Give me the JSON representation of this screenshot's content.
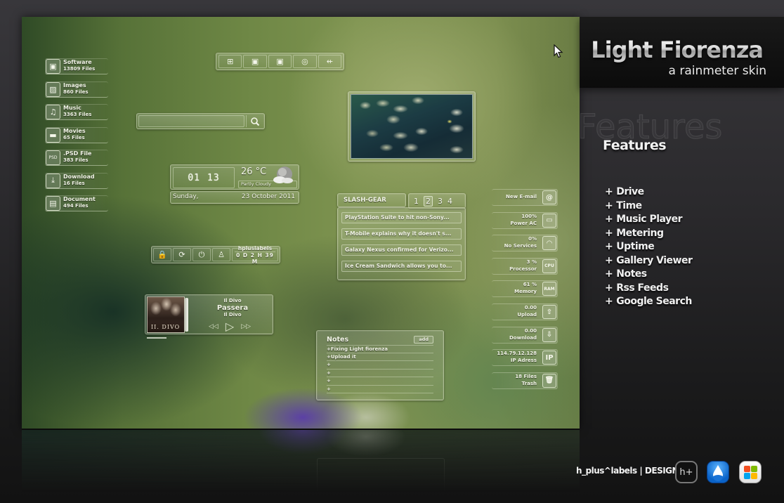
{
  "desktop": {
    "drives": [
      {
        "name": "Software",
        "count": "13809 Files",
        "icon": "software-icon",
        "glyph": "▣"
      },
      {
        "name": "Images",
        "count": "860 Files",
        "icon": "images-icon",
        "glyph": "▨"
      },
      {
        "name": "Music",
        "count": "3363 Files",
        "icon": "music-icon",
        "glyph": "♫"
      },
      {
        "name": "Movies",
        "count": "65 Files",
        "icon": "movies-icon",
        "glyph": "▬"
      },
      {
        "name": ".PSD File",
        "count": "383 Files",
        "icon": "psd-icon",
        "glyph": "PSD"
      },
      {
        "name": "Download",
        "count": "16 Files",
        "icon": "download-icon",
        "glyph": "⤓"
      },
      {
        "name": "Document",
        "count": "494 Files",
        "icon": "document-icon",
        "glyph": "▤"
      }
    ],
    "launcher": [
      {
        "icon": "windows-icon",
        "glyph": "⊞"
      },
      {
        "icon": "drive-icon",
        "glyph": "▣"
      },
      {
        "icon": "drive-icon",
        "glyph": "▣"
      },
      {
        "icon": "disc-icon",
        "glyph": "◎"
      },
      {
        "icon": "usb-icon",
        "glyph": "⇷"
      }
    ],
    "search": {
      "value": "",
      "placeholder": ""
    },
    "clock": {
      "hours": "01",
      "minutes": "13",
      "temperature": "26 °C",
      "condition": "Partly Cloudy",
      "day": "Sunday,",
      "date": "23 October 2011"
    },
    "uptime": {
      "buttons": [
        {
          "icon": "lock-icon",
          "glyph": "🔒"
        },
        {
          "icon": "refresh-icon",
          "glyph": "⟳"
        },
        {
          "icon": "power-icon",
          "glyph": "⏻"
        },
        {
          "icon": "user-icon",
          "glyph": "♙"
        }
      ],
      "user": "hpluslabels",
      "time": "0 D 2 H 39 M"
    },
    "music": {
      "album_text": "II. DIVO",
      "artist_top": "Il Divo",
      "title": "Passera",
      "artist": "Il Divo",
      "prev": "◁◁",
      "play": "▷",
      "next": "▷▷"
    },
    "rss": {
      "source": "SLASH-GEAR",
      "pages": [
        "1",
        "2",
        "3",
        "4"
      ],
      "active_page": "2",
      "items": [
        "PlayStation Suite to hit non-Sony...",
        "T-Mobile explains why it doesn't s...",
        "Galaxy Nexus confirmed for Verizo...",
        "Ice Cream Sandwich allows you to..."
      ]
    },
    "notes": {
      "title": "Notes",
      "add_label": "add",
      "lines": [
        "+Fixing Light fiorenza",
        "+Upload it",
        "+",
        "+",
        "+",
        "+"
      ]
    },
    "meters": [
      {
        "value": "",
        "label": "New E-mail",
        "icon": "email-icon",
        "glyph": "@"
      },
      {
        "value": "100%",
        "label": "Power AC",
        "icon": "battery-icon",
        "glyph": "▭"
      },
      {
        "value": "0%",
        "label": "No Services",
        "icon": "wifi-icon",
        "glyph": "◠"
      },
      {
        "value": "3 %",
        "label": "Processor",
        "icon": "cpu-icon",
        "glyph": "CPU"
      },
      {
        "value": "61 %",
        "label": "Memory",
        "icon": "ram-icon",
        "glyph": "RAM"
      },
      {
        "value": "0.00",
        "label": "Upload",
        "icon": "upload-icon",
        "glyph": "⇧"
      },
      {
        "value": "0.00",
        "label": "Download",
        "icon": "download-arrow-icon",
        "glyph": "⇩"
      },
      {
        "value": "114.79.12.128",
        "label": "IP Adress",
        "icon": "ip-icon",
        "glyph": "IP"
      },
      {
        "value": "18 Files",
        "label": "Trash",
        "icon": "trash-icon",
        "glyph": "🗑"
      }
    ]
  },
  "panel": {
    "title": "Light Fiorenza",
    "subtitle": "a rainmeter skin",
    "features_ghost": "Features",
    "features_title": "Features",
    "features": [
      "Drive",
      "Time",
      "Music Player",
      "Metering",
      "Uptime",
      "Gallery Viewer",
      "Notes",
      "Rss Feeds",
      "Google Search"
    ],
    "plus": "+",
    "credit": "h_plus^labels | DESIGN",
    "logo_hp_text": "h+"
  }
}
